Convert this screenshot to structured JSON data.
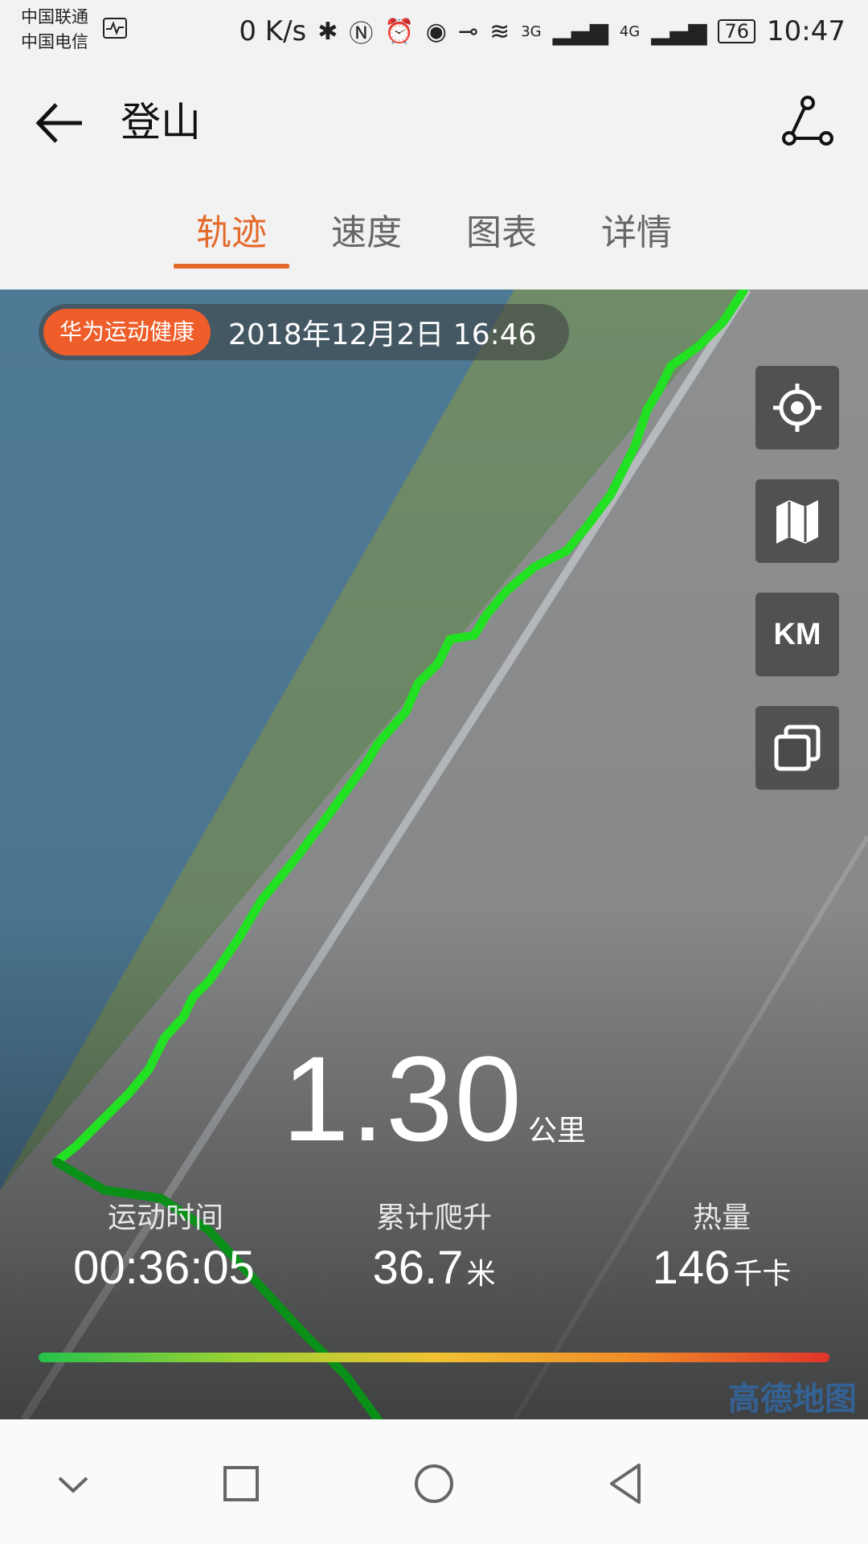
{
  "status_bar": {
    "carrier1": "中国联通",
    "carrier2": "中国电信",
    "net_speed": "0 K/s",
    "net_3g": "3G",
    "net_4g": "4G",
    "battery": "76",
    "time": "10:47"
  },
  "app_bar": {
    "title": "登山"
  },
  "tabs": [
    {
      "label": "轨迹",
      "active": true
    },
    {
      "label": "速度",
      "active": false
    },
    {
      "label": "图表",
      "active": false
    },
    {
      "label": "详情",
      "active": false
    }
  ],
  "map": {
    "brand": "华为运动健康",
    "datetime": "2018年12月2日 16:46",
    "buttons": {
      "km_label": "KM"
    },
    "watermark": "高德地图"
  },
  "summary": {
    "distance_value": "1.30",
    "distance_unit": "公里",
    "stats": [
      {
        "label": "运动时间",
        "value": "00:36:05",
        "unit": ""
      },
      {
        "label": "累计爬升",
        "value": "36.7",
        "unit": "米"
      },
      {
        "label": "热量",
        "value": "146",
        "unit": "千卡"
      }
    ]
  },
  "colors": {
    "accent": "#e46a2c",
    "brand_pill": "#ee5d2a",
    "track": "#22e022",
    "track_slow": "#0a8f18"
  },
  "icons": [
    "back-arrow-icon",
    "route-icon",
    "locate-icon",
    "map-icon",
    "layers-icon",
    "nav-down-icon",
    "nav-square-icon",
    "nav-circle-icon",
    "nav-back-icon"
  ]
}
